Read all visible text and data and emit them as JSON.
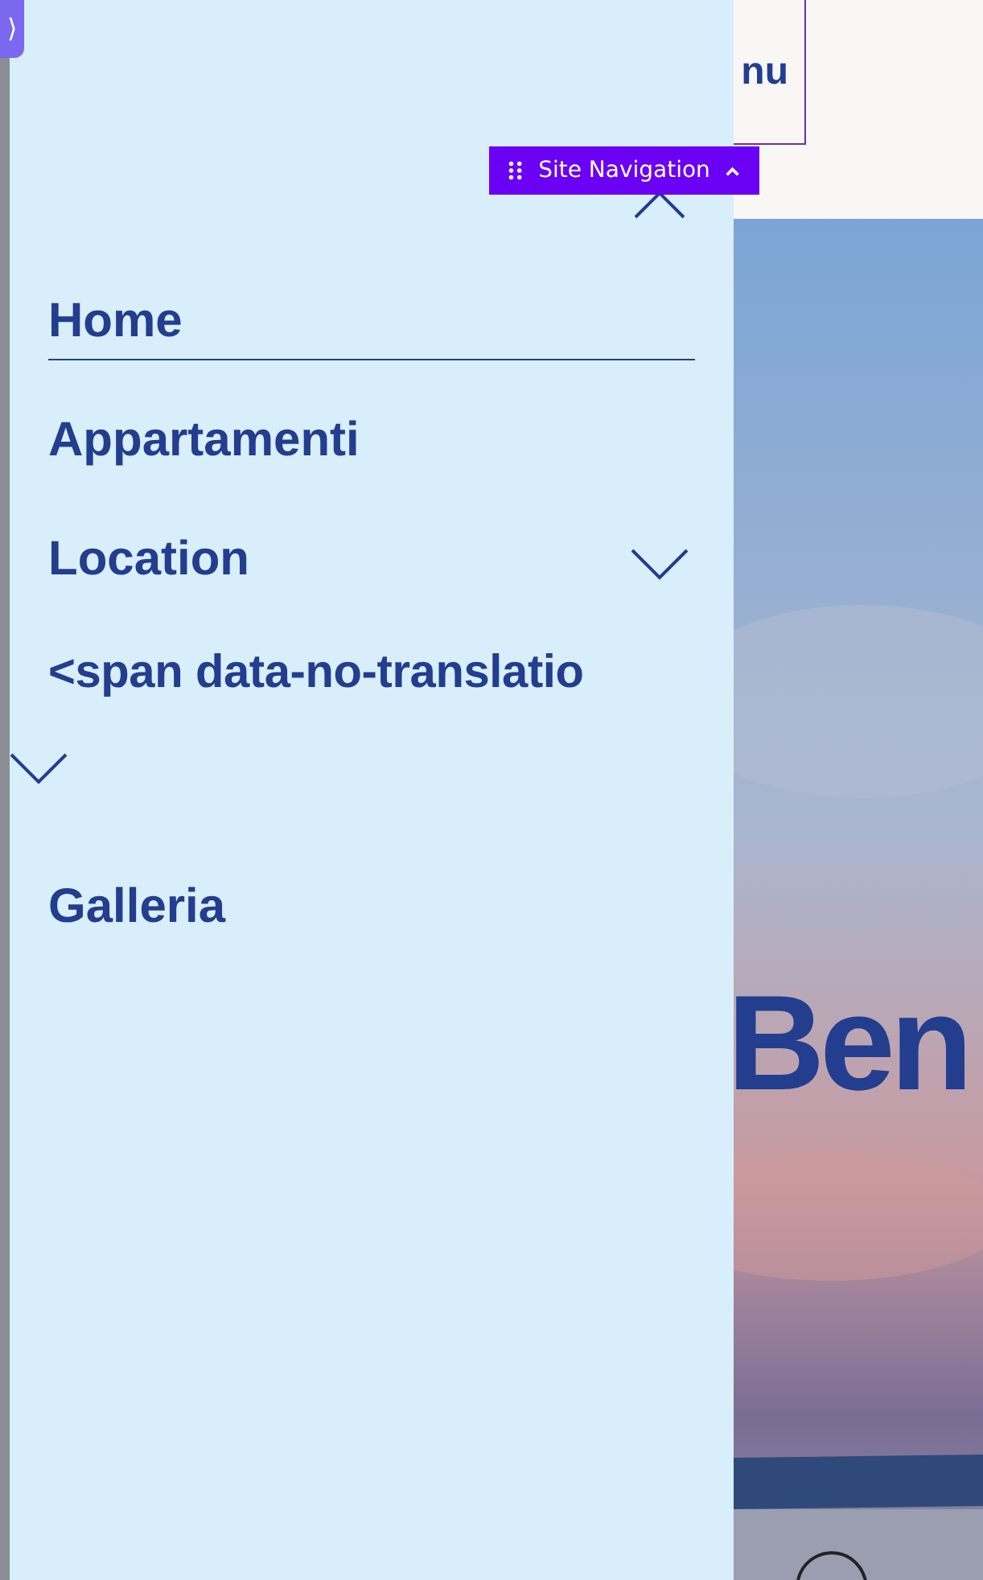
{
  "editor_tab": {
    "label": "⟩"
  },
  "header": {
    "menu_label": "nu"
  },
  "editor_badge": {
    "label": "Site Navigation"
  },
  "menu": [
    {
      "label": "Home",
      "selected": true,
      "expandable": false
    },
    {
      "label": "Appartamenti",
      "selected": false,
      "expandable": false
    },
    {
      "label": "Location",
      "selected": false,
      "expandable": true
    },
    {
      "label": "<span data-no-translatio",
      "selected": false,
      "expandable": true,
      "wrapped": true
    },
    {
      "label": "Galleria",
      "selected": false,
      "expandable": false
    }
  ],
  "hero": {
    "heading": "Ben"
  }
}
